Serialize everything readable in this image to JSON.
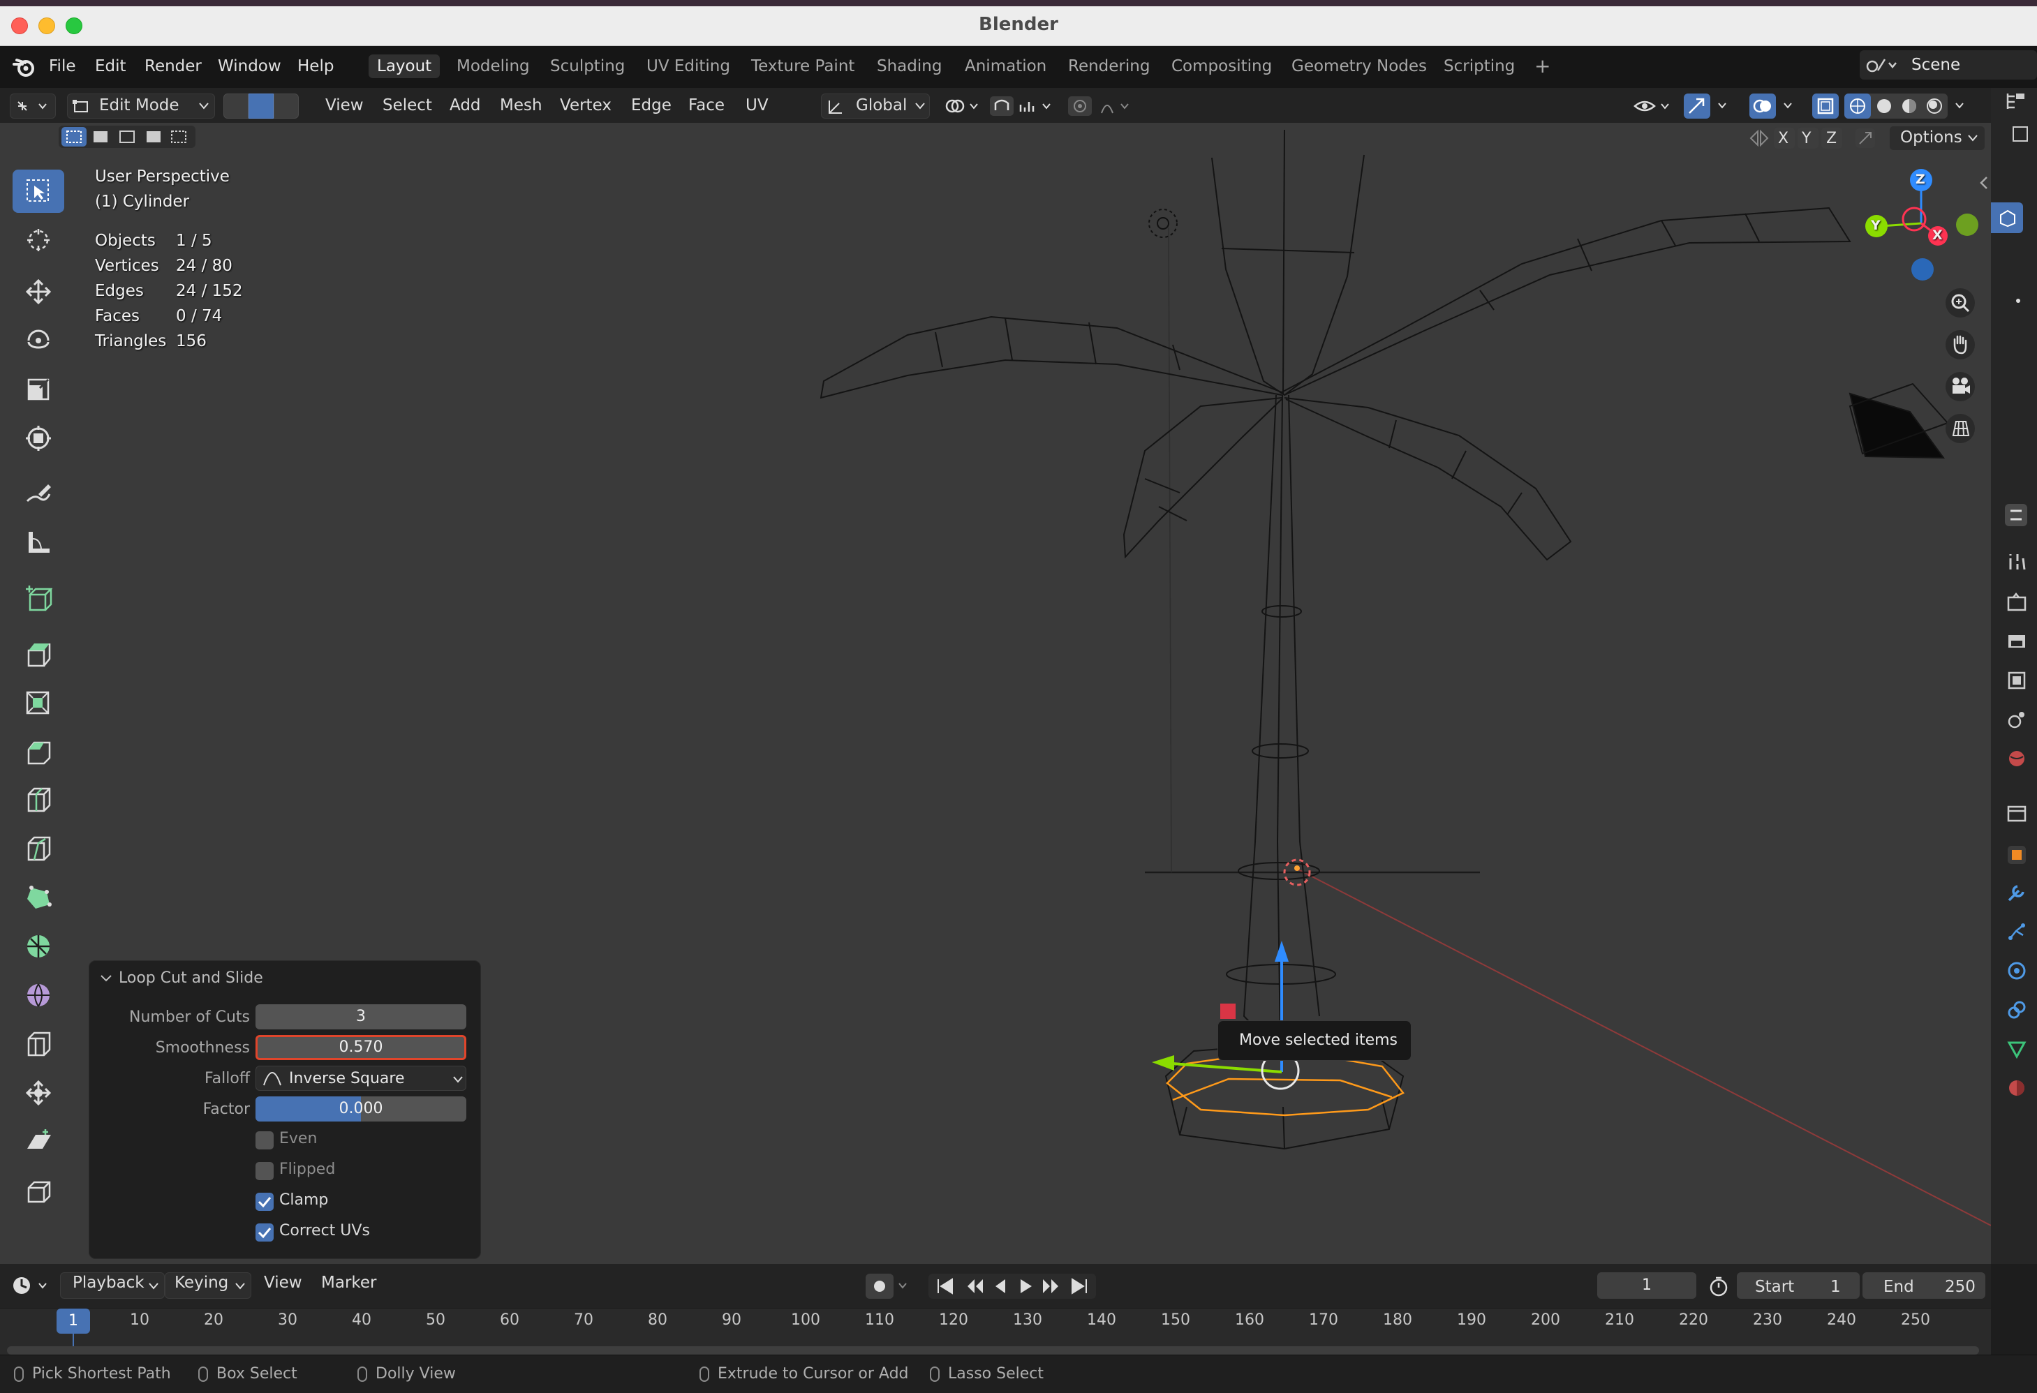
{
  "window": {
    "title": "Blender"
  },
  "menu": {
    "items": [
      "File",
      "Edit",
      "Render",
      "Window",
      "Help"
    ],
    "workspaces": [
      "Layout",
      "Modeling",
      "Sculpting",
      "UV Editing",
      "Texture Paint",
      "Shading",
      "Animation",
      "Rendering",
      "Compositing",
      "Geometry Nodes",
      "Scripting"
    ],
    "active_workspace": "Layout",
    "add_tab_symbol": "+",
    "scene": "Scene"
  },
  "viewport_header": {
    "mode": "Edit Mode",
    "menus": [
      "View",
      "Select",
      "Add",
      "Mesh",
      "Vertex",
      "Edge",
      "Face",
      "UV"
    ],
    "transform_orientation": "Global",
    "axes": [
      "X",
      "Y",
      "Z"
    ],
    "options_label": "Options",
    "select_mode_active": "edge"
  },
  "overlay": {
    "view_name": "User Perspective",
    "object_name": "(1) Cylinder",
    "stats": [
      {
        "label": "Objects",
        "value": "1 / 5"
      },
      {
        "label": "Vertices",
        "value": "24 / 80"
      },
      {
        "label": "Edges",
        "value": "24 / 152"
      },
      {
        "label": "Faces",
        "value": "0 / 74"
      },
      {
        "label": "Triangles",
        "value": "156"
      }
    ]
  },
  "gizmo": {
    "z": "Z",
    "y": "Y",
    "x": "X"
  },
  "operator_panel": {
    "title": "Loop Cut and Slide",
    "number_of_cuts_label": "Number of Cuts",
    "number_of_cuts": "3",
    "smoothness_label": "Smoothness",
    "smoothness": "0.570",
    "falloff_label": "Falloff",
    "falloff": "Inverse Square",
    "factor_label": "Factor",
    "factor": "0.000",
    "even_label": "Even",
    "even": false,
    "flipped_label": "Flipped",
    "flipped": false,
    "clamp_label": "Clamp",
    "clamp": true,
    "correct_uvs_label": "Correct UVs",
    "correct_uvs": true
  },
  "tooltip": {
    "text": "Move selected items"
  },
  "timeline": {
    "menus": [
      "Playback",
      "Keying",
      "View",
      "Marker"
    ],
    "current_frame": "1",
    "start_label": "Start",
    "start": "1",
    "end_label": "End",
    "end": "250",
    "ticks": [
      "10",
      "20",
      "30",
      "40",
      "50",
      "60",
      "70",
      "80",
      "90",
      "100",
      "110",
      "120",
      "130",
      "140",
      "150",
      "160",
      "170",
      "180",
      "190",
      "200",
      "210",
      "220",
      "230",
      "240",
      "250"
    ],
    "playhead_label": "1"
  },
  "statusbar": {
    "items": [
      "Pick Shortest Path",
      "Box Select",
      "Dolly View",
      "Extrude to Cursor or Add",
      "Lasso Select"
    ]
  },
  "colors": {
    "accent": "#4772b3",
    "selection": "#ff9a1a",
    "highlight_border": "#e0452b",
    "axis_x": "#ff3352",
    "axis_y": "#8bdc00",
    "axis_z": "#2890ff"
  }
}
